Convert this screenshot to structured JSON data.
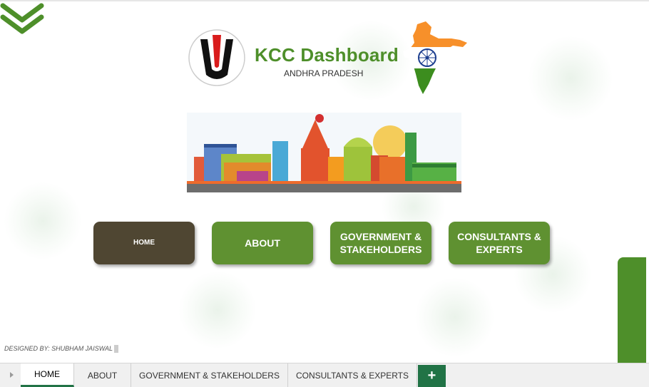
{
  "header": {
    "title": "KCC Dashboard",
    "subtitle": "ANDHRA PRADESH",
    "logo_icon": "tilak-emblem-icon",
    "map_icon": "india-map-icon"
  },
  "banner": {
    "icon": "city-skyline-illustration"
  },
  "nav_buttons": [
    {
      "label": "HOME"
    },
    {
      "label": "ABOUT"
    },
    {
      "label": "GOVERNMENT & STAKEHOLDERS"
    },
    {
      "label": "CONSULTANTS & EXPERTS"
    }
  ],
  "credit": "DESIGNED BY: SHUBHAM JAISWAL",
  "sheet_tabs": [
    {
      "label": "HOME",
      "active": true
    },
    {
      "label": "ABOUT",
      "active": false
    },
    {
      "label": "GOVERNMENT & STAKEHOLDERS",
      "active": false
    },
    {
      "label": "CONSULTANTS & EXPERTS",
      "active": false
    }
  ],
  "add_tab_label": "+",
  "colors": {
    "brand_green": "#4e8f2a",
    "button_green": "#5f9131",
    "home_button": "#4f4632",
    "tab_accent": "#217346"
  }
}
